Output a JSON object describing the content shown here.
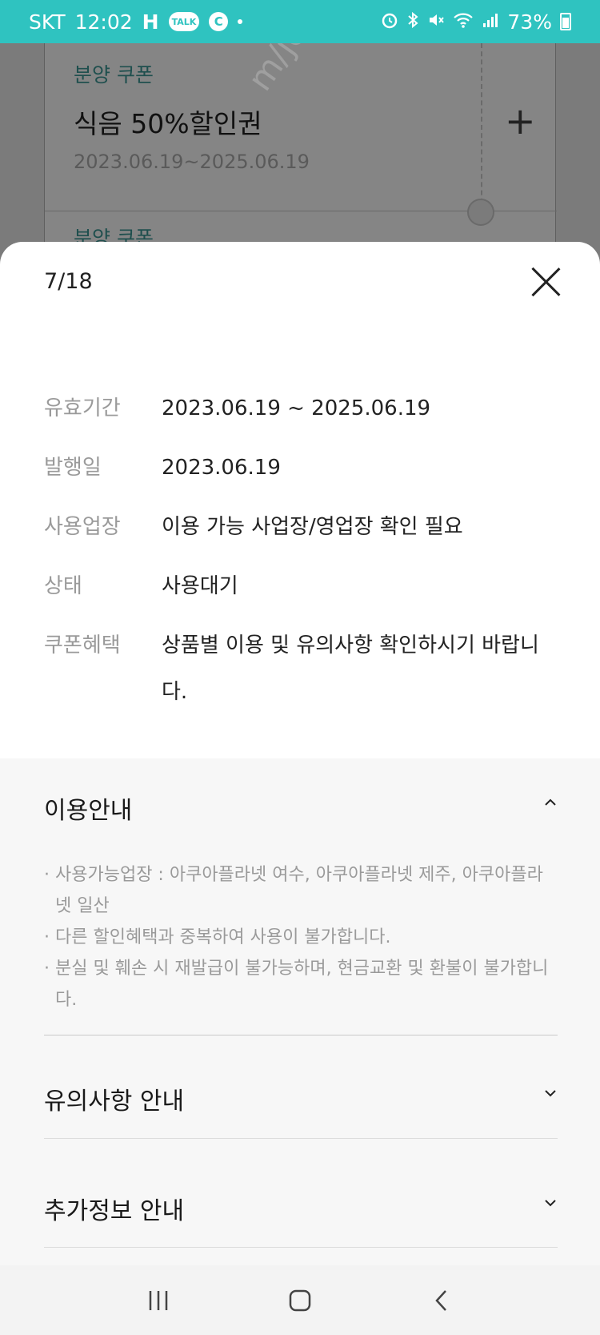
{
  "status_bar": {
    "carrier": "SKT",
    "time": "12:02",
    "network_letter": "H",
    "talk_badge": "TALK",
    "c_badge": "C",
    "battery": "73%",
    "icons": [
      "alarm-icon",
      "bluetooth-icon",
      "mute-icon",
      "wifi-icon",
      "signal-icon",
      "battery-icon"
    ]
  },
  "background_coupon": {
    "type": "분양 쿠폰",
    "name": "식음 50%할인권",
    "period": "2023.06.19~2025.06.19",
    "next_type": "분양 쿠폰"
  },
  "watermark": "m/joonggonara",
  "sheet": {
    "counter": "7/18",
    "details": [
      {
        "label": "유효기간",
        "value": "2023.06.19 ~ 2025.06.19"
      },
      {
        "label": "발행일",
        "value": "2023.06.19"
      },
      {
        "label": "사용업장",
        "value": "이용 가능 사업장/영업장 확인 필요"
      },
      {
        "label": "상태",
        "value": "사용대기"
      },
      {
        "label": "쿠폰혜택",
        "value": "상품별 이용 및 유의사항 확인하시기 바랍니다."
      }
    ],
    "sections": {
      "usage": {
        "title": "이용안내",
        "expanded": true,
        "items": [
          "사용가능업장 : 아쿠아플라넷 여수, 아쿠아플라넷 제주, 아쿠아플라넷 일산",
          "다른 할인혜택과 중복하여 사용이 불가합니다.",
          "분실 및 훼손 시 재발급이 불가능하며, 현금교환 및 환불이 불가합니다."
        ]
      },
      "caution": {
        "title": "유의사항 안내",
        "expanded": false
      },
      "extra": {
        "title": "추가정보 안내",
        "expanded": false
      }
    }
  },
  "nav_bar": {
    "buttons": [
      "recent-apps-icon",
      "home-icon",
      "back-icon"
    ]
  },
  "colors": {
    "status_bar": "#2fc3c0",
    "label_gray": "#9a9a9a",
    "text_dark": "#222222"
  }
}
